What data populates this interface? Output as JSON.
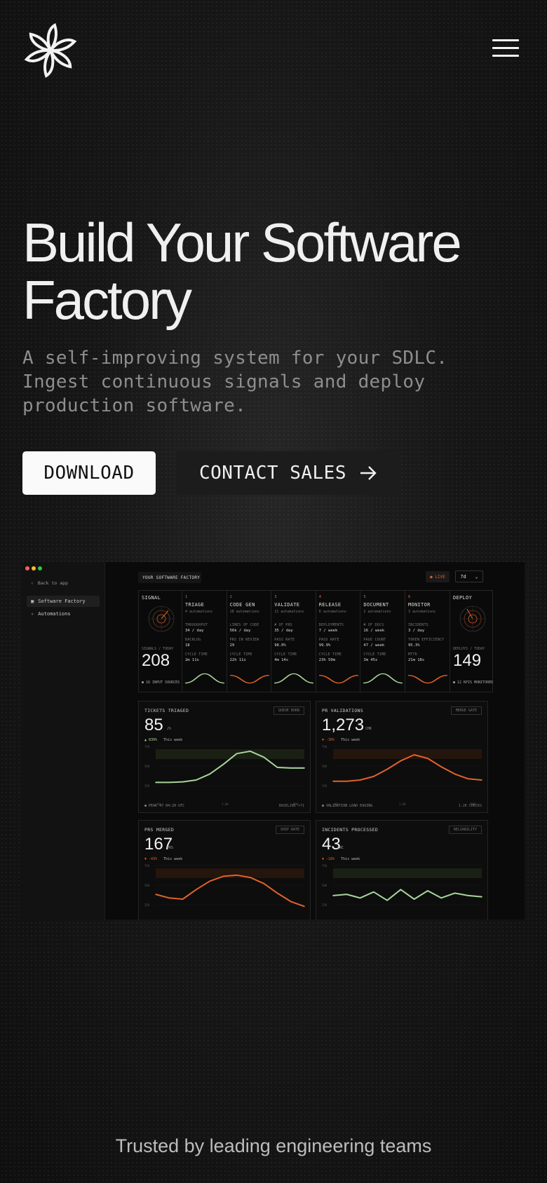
{
  "header": {
    "logo_icon": "asterisk-petal-logo-icon",
    "menu_icon": "hamburger-menu-icon"
  },
  "hero": {
    "title": "Build Your Software Factory",
    "subtitle": "A self-improving system for your SDLC. Ingest continuous signals and deploy production software.",
    "download_label": "DOWNLOAD",
    "contact_label": "CONTACT SALES",
    "contact_icon": "arrow-right-icon"
  },
  "app": {
    "back_label": "Back to app",
    "nav": [
      {
        "label": "Software Factory"
      },
      {
        "label": "Automations"
      }
    ],
    "header_title": "YOUR SOFTWARE FACTORY",
    "live_label": "● LIVE",
    "range_value": "7d",
    "signal": {
      "title": "SIGNAL",
      "caption": "SIGNALS / TODAY",
      "value": "208",
      "footer": "● 16 INPUT SOURCES"
    },
    "deploy": {
      "title": "DEPLOY",
      "caption": "DEPLOYS / TODAY",
      "value": "149",
      "footer": "● 12 KPIS MONITORED"
    },
    "stages": [
      {
        "num": "1",
        "name": "TRIAGE",
        "sub": "4 automations",
        "r1l": "THROUGHPUT",
        "r1v": "34 / day",
        "r2l": "BACKLOG",
        "r2v": "18",
        "r3l": "CYCLE TIME",
        "r3v": "2m 11s"
      },
      {
        "num": "2",
        "name": "CODE GEN",
        "sub": "18 automations",
        "r1l": "LINES OF CODE",
        "r1v": "56k / day",
        "r2l": "PRS IN REVIEW",
        "r2v": "29",
        "r3l": "CYCLE TIME",
        "r3v": "22h 11s"
      },
      {
        "num": "3",
        "name": "VALIDATE",
        "sub": "11 automations",
        "r1l": "# OF PRS",
        "r1v": "35 / day",
        "r2l": "PASS RATE",
        "r2v": "98.0%",
        "r3l": "CYCLE TIME",
        "r3v": "4m 14s"
      },
      {
        "num": "4",
        "name": "RELEASE",
        "sub": "6 automations",
        "r1l": "DEPLOYMENTS",
        "r1v": "7 / week",
        "r2l": "PASS RATE",
        "r2v": "99.9%",
        "r3l": "CYCLE TIME",
        "r3v": "23h 50m"
      },
      {
        "num": "5",
        "name": "DOCUMENT",
        "sub": "2 automations",
        "r1l": "# OF DOCS",
        "r1v": "16 / week",
        "r2l": "PAGE COUNT",
        "r2v": "47 / week",
        "r3l": "CYCLE TIME",
        "r3v": "3m 45s"
      },
      {
        "num": "6",
        "name": "MONITOR",
        "sub": "3 automations",
        "r1l": "INCIDENTS",
        "r1v": "3 / day",
        "r2l": "TOKEN EFFICIENCY",
        "r2v": "95.3%",
        "r3l": "MTTR",
        "r3v": "21m 18s"
      }
    ],
    "cards": [
      {
        "title": "TICKETS TRIAGED",
        "tag": "QUEUE BURN",
        "value": "85",
        "unit": "/h",
        "delta": "▲ 830%",
        "period": "This week",
        "footer": "● PEAK 47 04:20 UTC",
        "footer_r": "BASELINE +71"
      },
      {
        "title": "PR VALIDATIONS",
        "tag": "MERGE GATE",
        "value": "1,273",
        "unit": "CHK",
        "delta": "▼ -30%",
        "period": "This week",
        "footer": "● VALIDATION LOAD EASING",
        "footer_r": "1.2K CHECKS"
      },
      {
        "title": "PRS MERGED",
        "tag": "SHIP RATE",
        "value": "167",
        "unit": "PRS",
        "delta": "▼ -43%",
        "period": "This week",
        "footer": "",
        "footer_r": ""
      },
      {
        "title": "INCIDENTS PROCESSED",
        "tag": "RELIABILITY",
        "value": "43",
        "unit": "INC",
        "delta": "▼ -18%",
        "period": "This week",
        "footer": "",
        "footer_r": ""
      }
    ],
    "axis": {
      "y": [
        "75K",
        "50K",
        "25K"
      ],
      "x": [
        "00",
        "1.00",
        "NOW"
      ]
    }
  },
  "chart_data": [
    {
      "type": "line",
      "title": "TICKETS TRIAGED",
      "color": "#a8d59a",
      "values": [
        10,
        10,
        11,
        14,
        24,
        40,
        58,
        62,
        52,
        35,
        34,
        34
      ]
    },
    {
      "type": "line",
      "title": "PR VALIDATIONS",
      "color": "#e3612a",
      "values": [
        12,
        12,
        14,
        20,
        32,
        46,
        56,
        50,
        36,
        24,
        16,
        14
      ]
    },
    {
      "type": "line",
      "title": "PRS MERGED",
      "color": "#e3612a",
      "values": [
        22,
        16,
        14,
        30,
        44,
        52,
        54,
        50,
        40,
        24,
        10,
        2
      ]
    },
    {
      "type": "line",
      "title": "INCIDENTS PROCESSED",
      "color": "#a8d59a",
      "values": [
        20,
        22,
        16,
        26,
        12,
        30,
        14,
        28,
        16,
        24,
        20,
        18
      ]
    }
  ],
  "colors": {
    "accent": "#e3612a",
    "green": "#a8d59a"
  },
  "footer": {
    "trusted": "Trusted by leading engineering teams"
  }
}
